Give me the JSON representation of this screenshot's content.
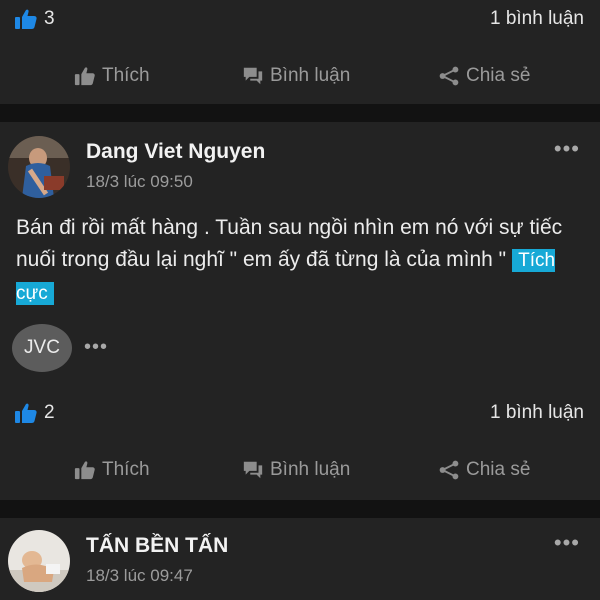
{
  "posts": [
    {
      "likes": "3",
      "comments": "1 bình luận"
    },
    {
      "author": "Dang Viet Nguyen",
      "time": "18/3 lúc 09:50",
      "text": "Bán đi rồi mất hàng . Tuần sau ngồi nhìn em nó với sự tiếc nuối trong đầu lại nghĩ \" em ấy đã từng là của mình \"",
      "tag": "Tích cực",
      "brand_badge": "JVC",
      "likes": "2",
      "comments": "1 bình luận"
    },
    {
      "author": "TẤN BỀN TẤN",
      "time": "18/3 lúc 09:47"
    }
  ],
  "actions": {
    "like": "Thích",
    "comment": "Bình luận",
    "share": "Chia sẻ"
  },
  "more_label": "•••",
  "colors": {
    "background": "#232323",
    "separator": "#121212",
    "like_blue": "#1e88e5",
    "tag_blue": "#17a9d6",
    "muted": "#9a9a9a"
  },
  "icons": [
    "thumbs-up-icon",
    "comment-icon",
    "share-icon",
    "more-icon"
  ]
}
